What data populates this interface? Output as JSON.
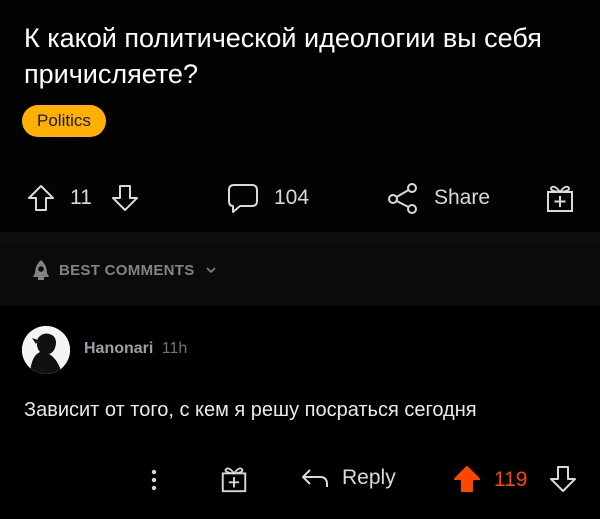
{
  "post": {
    "title": "К какой политической идеологии вы себя причисляете?",
    "flair": "Politics",
    "votes": "11",
    "comments": "104",
    "share_label": "Share"
  },
  "best_comments": {
    "label": "BEST COMMENTS"
  },
  "comment": {
    "author": "Hanonari",
    "time": "11h",
    "text": "Зависит от того, с кем я решу посраться сегодня",
    "reply_label": "Reply",
    "votes": "119"
  },
  "colors": {
    "flair_bg": "#ffb000",
    "upvote": "#ff4500",
    "text": "#d7dadc",
    "muted": "#818384"
  }
}
